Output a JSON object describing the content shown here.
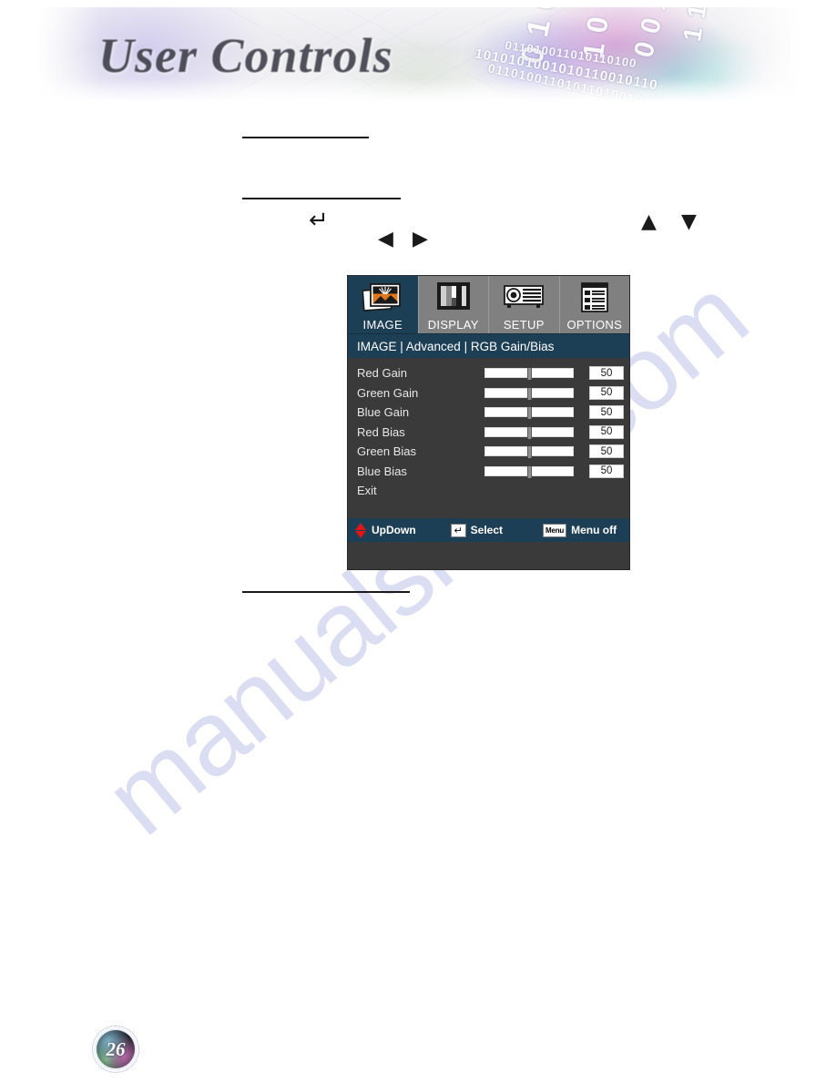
{
  "header": {
    "title": "User Controls"
  },
  "watermark": {
    "text": "manualshive.com"
  },
  "osd": {
    "tabs": [
      {
        "label": "IMAGE",
        "icon": "image-tab-icon",
        "active": true
      },
      {
        "label": "DISPLAY",
        "icon": "display-tab-icon",
        "active": false
      },
      {
        "label": "SETUP",
        "icon": "setup-tab-icon",
        "active": false
      },
      {
        "label": "OPTIONS",
        "icon": "options-tab-icon",
        "active": false
      }
    ],
    "breadcrumb": "IMAGE | Advanced | RGB Gain/Bias",
    "rows": [
      {
        "label": "Red Gain",
        "value": "50",
        "slider_percent": 50
      },
      {
        "label": "Green Gain",
        "value": "50",
        "slider_percent": 50
      },
      {
        "label": "Blue Gain",
        "value": "50",
        "slider_percent": 50
      },
      {
        "label": "Red Bias",
        "value": "50",
        "slider_percent": 50
      },
      {
        "label": "Green Bias",
        "value": "50",
        "slider_percent": 50
      },
      {
        "label": "Blue Bias",
        "value": "50",
        "slider_percent": 50
      }
    ],
    "exit_label": "Exit",
    "footer": {
      "updown_label": "UpDown",
      "select_key": "↵",
      "select_label": "Select",
      "menu_key": "Menu",
      "menu_label": "Menu off"
    },
    "colors": {
      "active_tab": "#1d3f55",
      "inactive_tab": "#808080",
      "body": "#3a3a3a",
      "bar": "#1d3f55",
      "updown_red": "#e01515"
    }
  },
  "glyphs": {
    "enter": "↵",
    "left": "◀",
    "right": "▶",
    "up": "▲",
    "down": "▼"
  },
  "page_number": "26"
}
